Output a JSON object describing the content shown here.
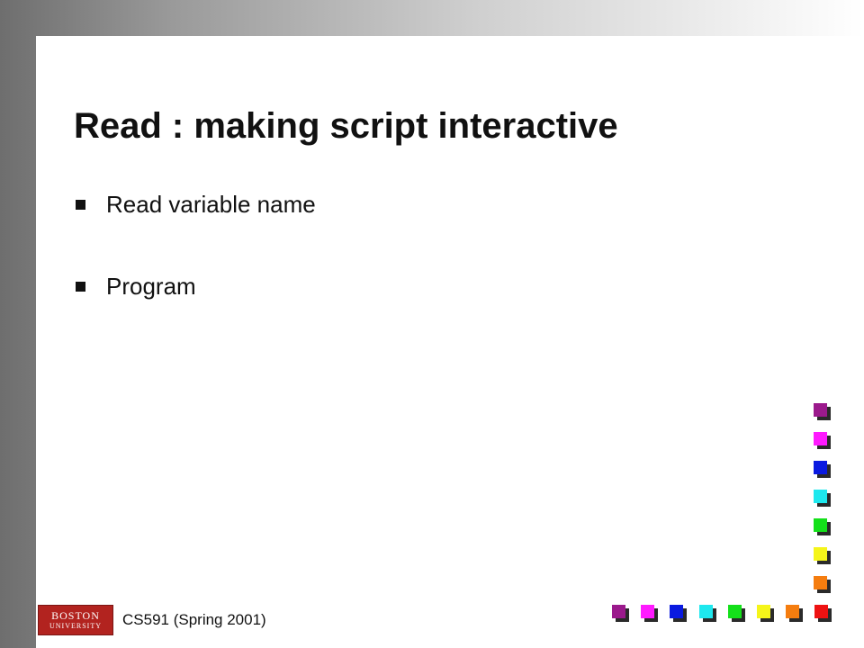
{
  "slide": {
    "title": "Read : making script interactive",
    "bullets": [
      {
        "text": "Read variable name"
      },
      {
        "text": "Program"
      }
    ]
  },
  "footer": {
    "course": "CS591 (Spring 2001)",
    "logo_line1": "BOSTON",
    "logo_line2": "UNIVERSITY"
  },
  "decoration": {
    "bottom_squares": [
      "#9b1a8c",
      "#ff1aff",
      "#0a1ae0",
      "#1ee8ee",
      "#14e01a",
      "#f5f51a",
      "#f57d0f",
      "#ee1212"
    ],
    "right_squares": [
      "#9b1a8c",
      "#ff1aff",
      "#0a1ae0",
      "#1ee8ee",
      "#14e01a",
      "#f5f51a",
      "#f57d0f"
    ],
    "bullet_color": "#111111"
  }
}
